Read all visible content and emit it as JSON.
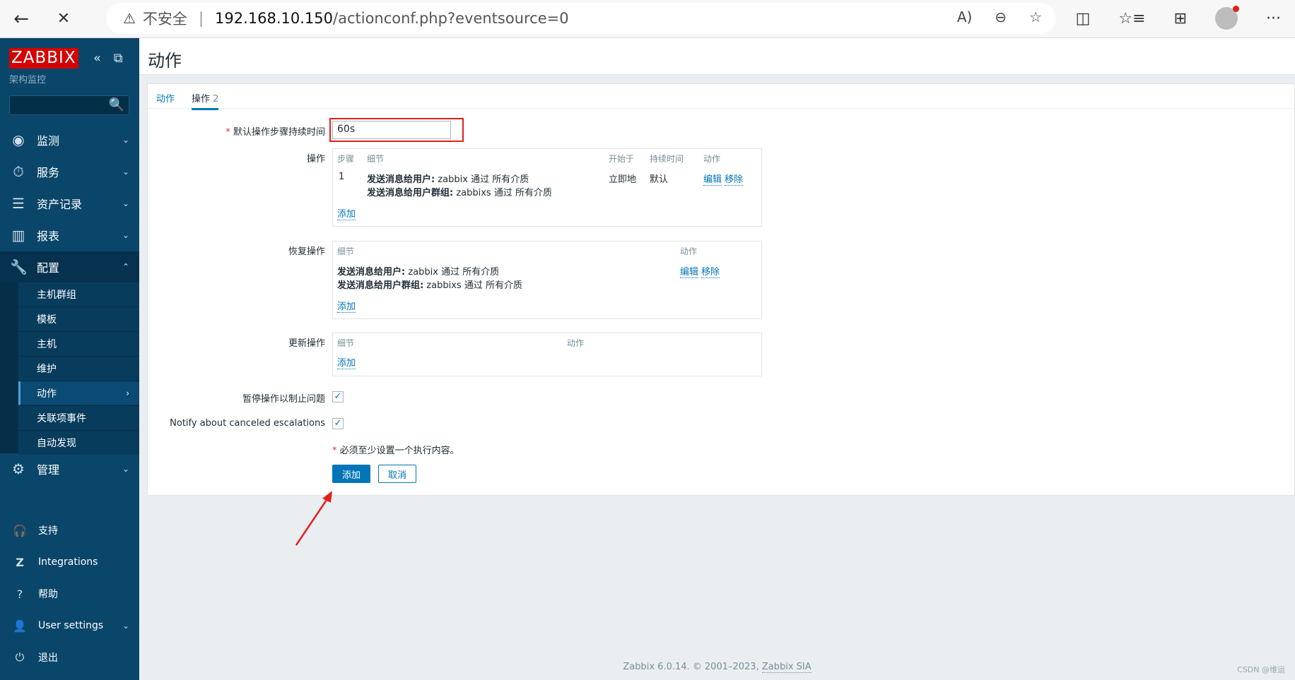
{
  "browser": {
    "back_icon": "←",
    "close_icon": "✕",
    "warning_icon": "⚠",
    "insecure_label": "不安全",
    "separator": "|",
    "url_host": "192.168.10.150",
    "url_path": "/actionconf.php?eventsource=0",
    "read_aloud_icon": "A)",
    "zoom_icon": "⊖",
    "favorite_add_icon": "☆",
    "split_icon": "◫",
    "favorites_icon": "☆≡",
    "collections_icon": "⊞",
    "more_icon": "···"
  },
  "sidebar": {
    "logo": "ZABBIX",
    "collapse_icons": "«  ⧉",
    "subtitle": "架构监控",
    "search_icon": "🔍",
    "menu": [
      {
        "label": "监测",
        "icon": "◉",
        "caret": "⌄"
      },
      {
        "label": "服务",
        "icon": "⏱",
        "caret": "⌄"
      },
      {
        "label": "资产记录",
        "icon": "☰",
        "caret": "⌄"
      },
      {
        "label": "报表",
        "icon": "▥",
        "caret": "⌄"
      },
      {
        "label": "配置",
        "icon": "🔧",
        "caret": "⌃"
      }
    ],
    "config_sub": [
      {
        "label": "主机群组"
      },
      {
        "label": "模板"
      },
      {
        "label": "主机"
      },
      {
        "label": "维护"
      },
      {
        "label": "动作",
        "caret": "›"
      },
      {
        "label": "关联项事件"
      },
      {
        "label": "自动发现"
      }
    ],
    "admin": {
      "label": "管理",
      "icon": "⚙",
      "caret": "⌄"
    },
    "bottom": [
      {
        "label": "支持",
        "icon": "🎧"
      },
      {
        "label": "Integrations",
        "icon": "Z"
      },
      {
        "label": "帮助",
        "icon": "?"
      },
      {
        "label": "User settings",
        "icon": "👤",
        "caret": "⌄"
      },
      {
        "label": "退出",
        "icon": "⏻"
      }
    ]
  },
  "page": {
    "title": "动作",
    "tabs": [
      {
        "label": "动作"
      },
      {
        "label": "操作",
        "count": "2"
      }
    ]
  },
  "form": {
    "required_mark": "*",
    "default_duration_label": "默认操作步骤持续时间",
    "default_duration_value": "60s",
    "operations": {
      "label": "操作",
      "headers": [
        "步骤",
        "细节",
        "开始于",
        "持续时间",
        "动作"
      ],
      "row": {
        "step": "1",
        "detail1_bold": "发送消息给用户:",
        "detail1_rest": " zabbix 通过 所有介质",
        "detail2_bold": "发送消息给用户群组:",
        "detail2_rest": " zabbixs 通过 所有介质",
        "start": "立即地",
        "duration": "默认",
        "edit": "编辑",
        "remove": "移除"
      },
      "add": "添加"
    },
    "recovery": {
      "label": "恢复操作",
      "headers": [
        "细节",
        "动作"
      ],
      "row": {
        "detail1_bold": "发送消息给用户:",
        "detail1_rest": " zabbix 通过 所有介质",
        "detail2_bold": "发送消息给用户群组:",
        "detail2_rest": " zabbixs 通过 所有介质",
        "edit": "编辑",
        "remove": "移除"
      },
      "add": "添加"
    },
    "update": {
      "label": "更新操作",
      "headers": [
        "细节",
        "动作"
      ],
      "add": "添加"
    },
    "pause_label": "暂停操作以制止问题",
    "pause_checked": true,
    "notify_label": "Notify about canceled escalations",
    "notify_checked": true,
    "check_mark": "✓",
    "note": "必须至少设置一个执行内容。",
    "add_button": "添加",
    "cancel_button": "取消"
  },
  "footer": {
    "text": "Zabbix 6.0.14. © 2001–2023, ",
    "link": "Zabbix SIA"
  },
  "watermark": "CSDN @维运"
}
